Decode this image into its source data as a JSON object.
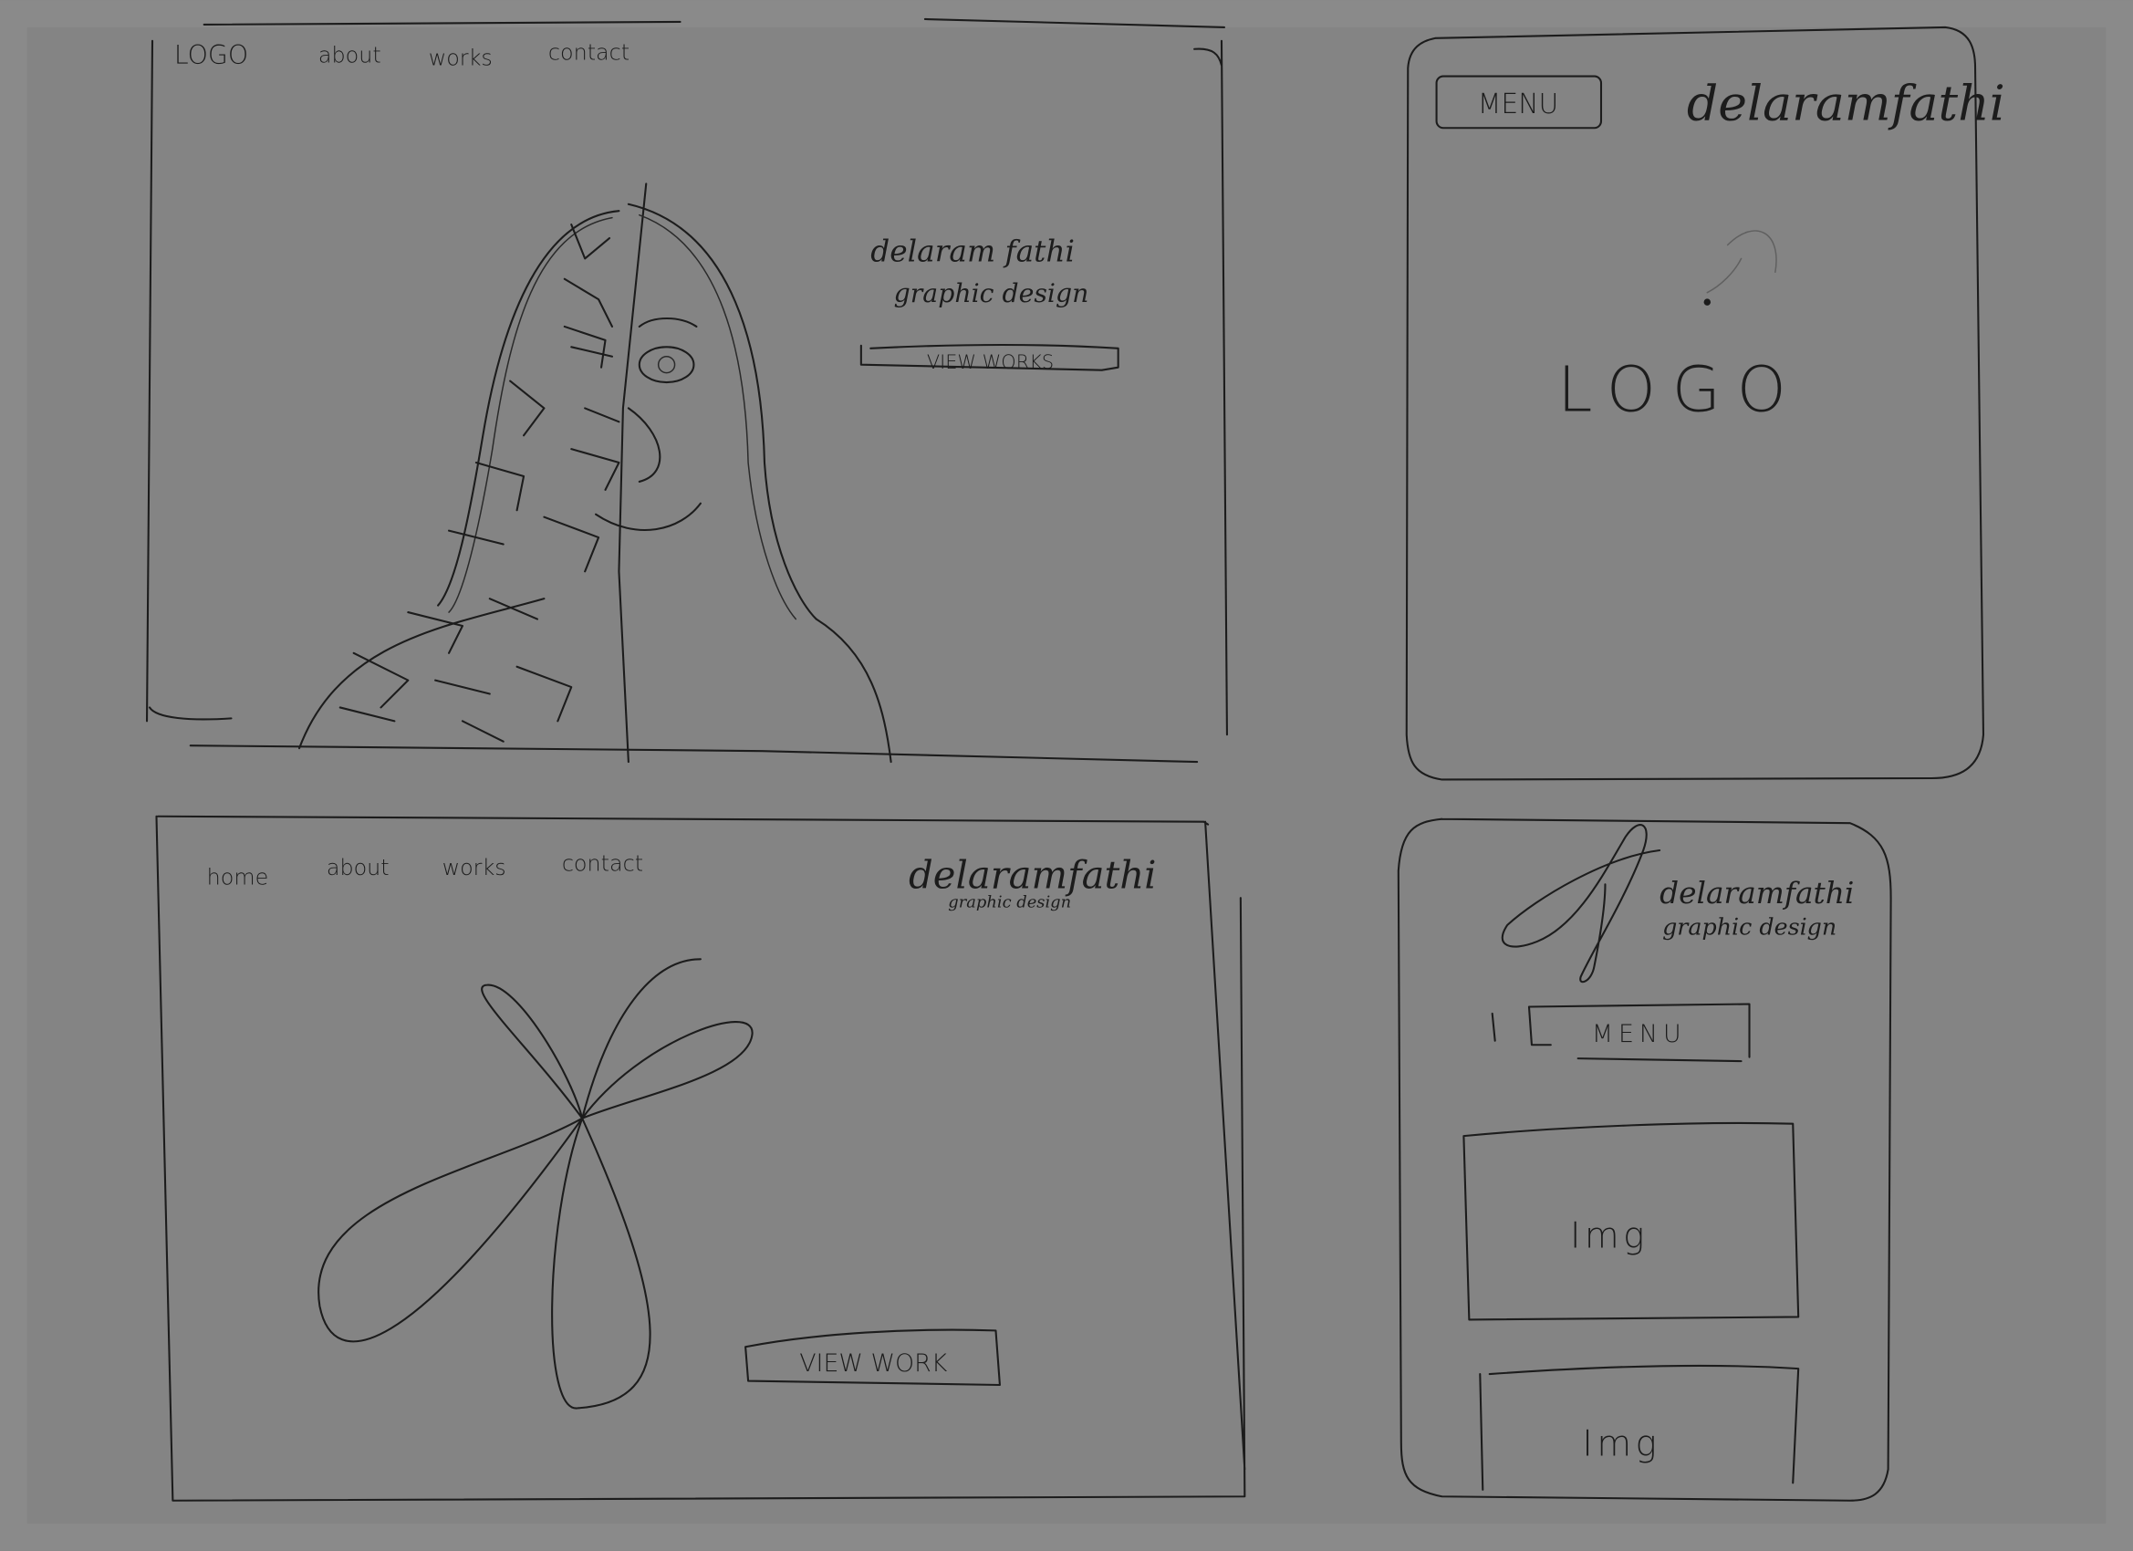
{
  "desktop_home": {
    "nav": [
      "LOGO",
      "about",
      "works",
      "contact"
    ],
    "name": "delaram fathi",
    "tagline": "graphic design",
    "cta": "VIEW WORKS"
  },
  "mobile_home": {
    "menu": "MENU",
    "name": "delaramfathi",
    "logo": "LOGO"
  },
  "desktop_works": {
    "nav": [
      "home",
      "about",
      "works",
      "contact"
    ],
    "name": "delaramfathi",
    "tagline": "graphic design",
    "cta": "VIEW WORK"
  },
  "mobile_works": {
    "name": "delaramfathi",
    "tagline": "graphic design",
    "menu": "MENU",
    "images": [
      "Img",
      "Img"
    ]
  },
  "colors": {
    "paper": "#858585",
    "ink": "#1c1c1c"
  }
}
